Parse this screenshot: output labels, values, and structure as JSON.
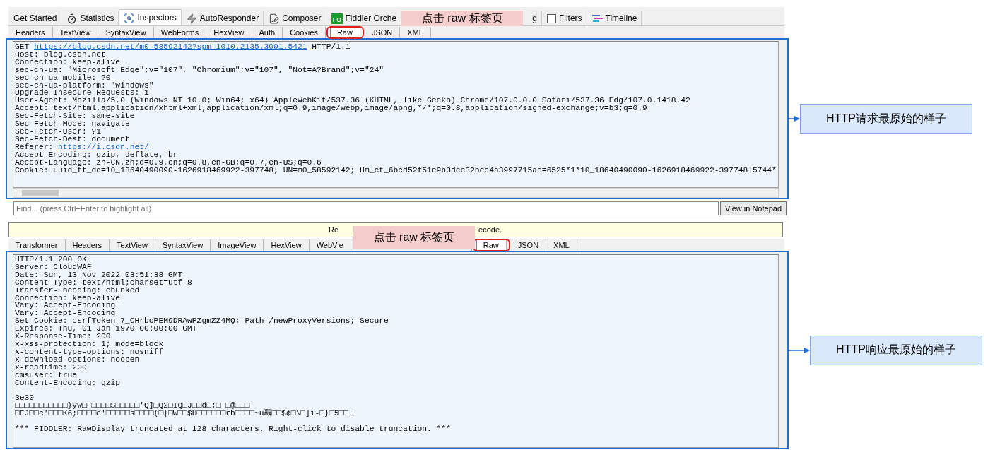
{
  "inspector_tabs": [
    {
      "kind": "plain",
      "label": "Get Started",
      "selected": false
    },
    {
      "kind": "stopwatch",
      "label": "Statistics",
      "selected": false
    },
    {
      "kind": "inspect",
      "label": "Inspectors",
      "selected": true
    },
    {
      "kind": "lightning",
      "label": "AutoResponder",
      "selected": false
    },
    {
      "kind": "compose",
      "label": "Composer",
      "selected": false
    },
    {
      "kind": "logo",
      "logo_text": "FO",
      "label": "Fiddler Orche",
      "selected": false
    },
    {
      "kind": "callout",
      "text": "点击 raw 标签页"
    },
    {
      "kind": "plain",
      "label": "g",
      "selected": false
    },
    {
      "kind": "checkbox",
      "label": "Filters",
      "checked": false,
      "selected": false
    },
    {
      "kind": "timeline",
      "label": "Timeline",
      "selected": false
    }
  ],
  "request": {
    "tabs": [
      {
        "label": "Headers",
        "selected": false
      },
      {
        "label": "TextView",
        "selected": false
      },
      {
        "label": "SyntaxView",
        "selected": false
      },
      {
        "label": "WebForms",
        "selected": false
      },
      {
        "label": "HexView",
        "selected": false
      },
      {
        "label": "Auth",
        "selected": false
      },
      {
        "label": "Cookies",
        "selected": false
      },
      {
        "label": "Raw",
        "selected": true,
        "highlighted": true
      },
      {
        "label": "JSON",
        "selected": false
      },
      {
        "label": "XML",
        "selected": false
      }
    ],
    "lines": [
      {
        "parts": [
          {
            "kind": "text",
            "text": "GET "
          },
          {
            "kind": "link",
            "text": "https://blog.csdn.net/m0_58592142?spm=1010.2135.3001.5421"
          },
          {
            "kind": "text",
            "text": " HTTP/1.1"
          }
        ]
      },
      "Host: blog.csdn.net",
      "Connection: keep-alive",
      "sec-ch-ua: \"Microsoft Edge\";v=\"107\", \"Chromium\";v=\"107\", \"Not=A?Brand\";v=\"24\"",
      "sec-ch-ua-mobile: ?0",
      "sec-ch-ua-platform: \"Windows\"",
      "Upgrade-Insecure-Requests: 1",
      "User-Agent: Mozilla/5.0 (Windows NT 10.0; Win64; x64) AppleWebKit/537.36 (KHTML, like Gecko) Chrome/107.0.0.0 Safari/537.36 Edg/107.0.1418.42",
      "Accept: text/html,application/xhtml+xml,application/xml;q=0.9,image/webp,image/apng,*/*;q=0.8,application/signed-exchange;v=b3;q=0.9",
      "Sec-Fetch-Site: same-site",
      "Sec-Fetch-Mode: navigate",
      "Sec-Fetch-User: ?1",
      "Sec-Fetch-Dest: document",
      {
        "parts": [
          {
            "kind": "text",
            "text": "Referer: "
          },
          {
            "kind": "link",
            "text": "https://i.csdn.net/"
          }
        ]
      },
      "Accept-Encoding: gzip, deflate, br",
      "Accept-Language: zh-CN,zh;q=0.9,en;q=0.8,en-GB;q=0.7,en-US;q=0.6",
      "Cookie: uuid_tt_dd=10_18640490090-1626918469922-397748; UN=m0_58592142; Hm_ct_6bcd52f51e9b3dce32bec4a3997715ac=6525*1*10_18640490090-1626918469922-397748!5744*"
    ],
    "annotation": "HTTP请求最原始的样子"
  },
  "find": {
    "placeholder": "Find... (press Ctrl+Enter to highlight all)",
    "button": "View in Notepad"
  },
  "notice": {
    "before": "Re",
    "after": "ecode.",
    "callout": "点击 raw 标签页"
  },
  "response": {
    "tabs": [
      {
        "label": "Transformer",
        "selected": false
      },
      {
        "label": "Headers",
        "selected": false
      },
      {
        "label": "TextView",
        "selected": false
      },
      {
        "label": "SyntaxView",
        "selected": false
      },
      {
        "label": "ImageView",
        "selected": false
      },
      {
        "label": "HexView",
        "selected": false
      },
      {
        "label": "WebVie",
        "selected": false
      },
      {
        "kind": "covered"
      },
      {
        "label": "Raw",
        "selected": true,
        "highlighted": true
      },
      {
        "label": "JSON",
        "selected": false
      },
      {
        "label": "XML",
        "selected": false
      }
    ],
    "lines": [
      "HTTP/1.1 200 OK",
      "Server: CloudWAF",
      "Date: Sun, 13 Nov 2022 03:51:38 GMT",
      "Content-Type: text/html;charset=utf-8",
      "Transfer-Encoding: chunked",
      "Connection: keep-alive",
      "Vary: Accept-Encoding",
      "Vary: Accept-Encoding",
      "Set-Cookie: csrfToken=7_CHrbcPEM9DRAwPZgmZZ4MQ; Path=/newProxyVersions; Secure",
      "Expires: Thu, 01 Jan 1970 00:00:00 GMT",
      "X-Response-Time: 200",
      "x-xss-protection: 1; mode=block",
      "x-content-type-options: nosniff",
      "x-download-options: noopen",
      "x-readtime: 200",
      "cmsuser: true",
      "Content-Encoding: gzip",
      {
        "gap_before": true,
        "text": "3e30"
      },
      "□□□□□□□□□□□}yw□F□□□□S□□□□□'Q]□Q2□IQ□J□□d□;□ □@□□□",
      "□EJ□□c'□□□K6;□□□□ĉ'□□□□□s□□□□(□|□W□□$H□□□□□□rb□□□□~u覊□□$¢□\\□]i-□}□5□□+",
      {
        "gap_before": true,
        "text": "*** FIDDLER: RawDisplay truncated at 128 characters. Right-click to disable truncation. ***"
      }
    ],
    "annotation": "HTTP响应最原始的样子"
  }
}
